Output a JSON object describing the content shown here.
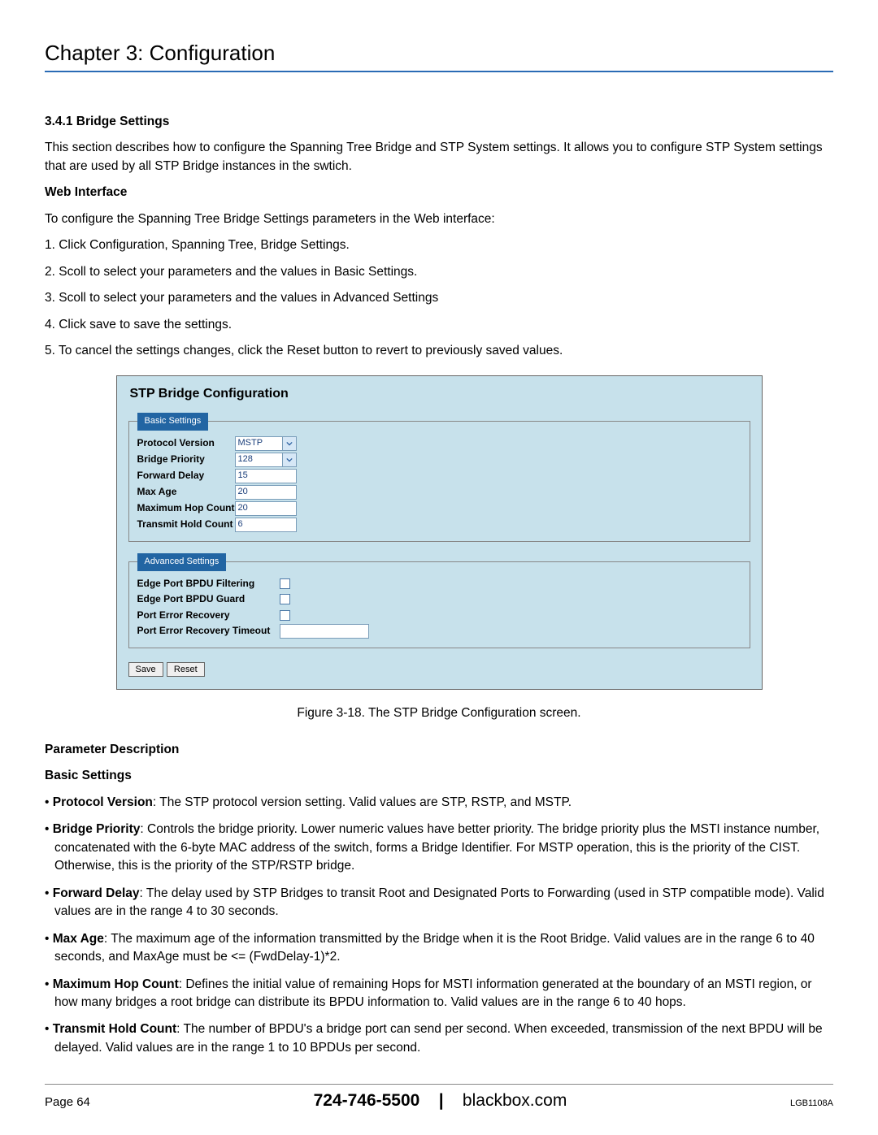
{
  "chapter_title": "Chapter 3: Configuration",
  "section_number": "3.4.1 Bridge Settings",
  "intro_para": "This section describes how to configure the Spanning Tree Bridge and STP System settings. It allows you to configure STP System settings that are used by all STP Bridge instances in the swtich.",
  "web_interface_head": "Web Interface",
  "web_interface_intro": "To configure the Spanning Tree Bridge Settings parameters in the Web interface:",
  "steps": [
    "1. Click Configuration, Spanning Tree, Bridge Settings.",
    "2. Scoll to select your parameters and the values in Basic Settings.",
    "3. Scoll to select your parameters and the values in Advanced Settings",
    "4. Click save to save the settings.",
    "5. To cancel the settings changes, click the Reset button to revert to previously saved values."
  ],
  "screenshot": {
    "title": "STP Bridge Configuration",
    "basic_legend": "Basic Settings",
    "basic_rows": {
      "protocol_version": {
        "label": "Protocol Version",
        "value": "MSTP",
        "type": "select"
      },
      "bridge_priority": {
        "label": "Bridge Priority",
        "value": "128",
        "type": "select"
      },
      "forward_delay": {
        "label": "Forward Delay",
        "value": "15",
        "type": "number"
      },
      "max_age": {
        "label": "Max Age",
        "value": "20",
        "type": "number"
      },
      "max_hop": {
        "label": "Maximum Hop Count",
        "value": "20",
        "type": "number"
      },
      "tx_hold": {
        "label": "Transmit Hold Count",
        "value": "6",
        "type": "number"
      }
    },
    "advanced_legend": "Advanced Settings",
    "advanced_rows": {
      "edge_filter": {
        "label": "Edge Port BPDU Filtering",
        "checked": false
      },
      "edge_guard": {
        "label": "Edge Port BPDU Guard",
        "checked": false
      },
      "port_err": {
        "label": "Port Error Recovery",
        "checked": false
      },
      "port_err_timeout": {
        "label": "Port Error Recovery Timeout",
        "value": ""
      }
    },
    "save_btn": "Save",
    "reset_btn": "Reset"
  },
  "caption": "Figure 3-18. The STP Bridge Configuration screen.",
  "param_desc_head": "Parameter Description",
  "basic_settings_head": "Basic Settings",
  "bullets": [
    {
      "term": "Protocol Version",
      "text": ": The STP protocol version setting. Valid values are STP, RSTP, and MSTP."
    },
    {
      "term": "Bridge Priority",
      "text": ": Controls the bridge priority. Lower numeric values have better priority. The bridge priority plus the MSTI instance number, concatenated with the 6-byte MAC address of the switch, forms a Bridge Identifier. For MSTP operation, this is the priority of the CIST. Otherwise, this is the priority of the STP/RSTP bridge."
    },
    {
      "term": "Forward Delay",
      "text": ": The delay used by STP Bridges to transit Root and Designated Ports to Forwarding (used in STP compatible mode). Valid values are in the range 4 to 30 seconds."
    },
    {
      "term": "Max Age",
      "text": ": The maximum age of the information transmitted by the Bridge when it is the Root Bridge. Valid values are in the range 6 to 40 seconds, and MaxAge must be <= (FwdDelay-1)*2."
    },
    {
      "term": "Maximum Hop Count",
      "text": ": Defines the initial value of remaining Hops for MSTI information generated at the boundary of an MSTI region, or how many bridges a root bridge can distribute its BPDU information to. Valid values are in the range 6 to 40 hops."
    },
    {
      "term": "Transmit Hold Count",
      "text": ": The number of BPDU's a bridge port can send per second. When exceeded, transmission of the next BPDU will be delayed. Valid values are in the range 1 to 10 BPDUs per second."
    }
  ],
  "footer": {
    "page": "Page 64",
    "phone": "724-746-5500",
    "sep": "|",
    "site": "blackbox.com",
    "model": "LGB1108A"
  }
}
